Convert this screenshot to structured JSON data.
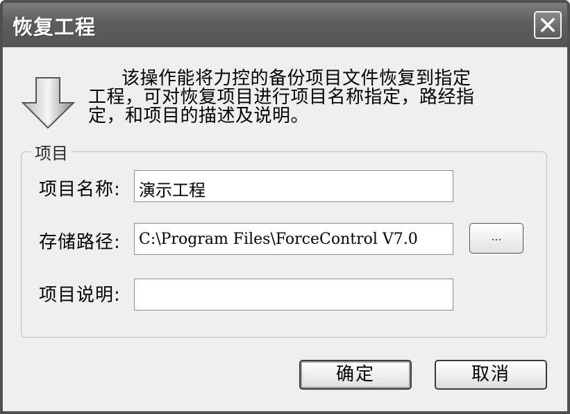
{
  "window": {
    "title": "恢复工程"
  },
  "description": {
    "line1": "该操作能将力控的备份项目文件恢复到指定",
    "line2": "工程，可对恢复项目进行项目名称指定，路经指",
    "line3": "定，和项目的描述及说明。"
  },
  "icon": {
    "main": "down-arrow-icon",
    "close": "close-icon"
  },
  "group": {
    "legend": "项目",
    "project_name": {
      "label": "项目名称:",
      "value": "演示工程"
    },
    "storage_path": {
      "label": "存储路径:",
      "value": "C:\\Program Files\\ForceControl V7.0",
      "browse_label": "..."
    },
    "project_note": {
      "label": "项目说明:",
      "value": ""
    }
  },
  "buttons": {
    "ok": "确定",
    "cancel": "取消"
  }
}
